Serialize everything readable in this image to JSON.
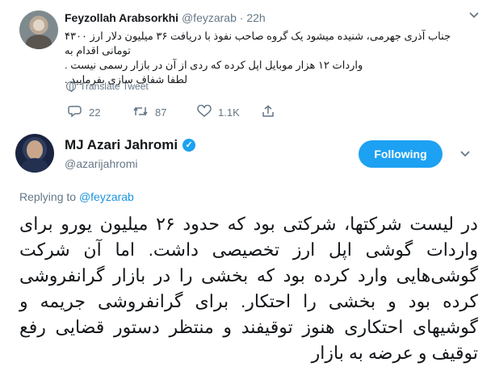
{
  "quoted_tweet": {
    "name": "Feyzollah Arabsorkhi",
    "handle": "@feyzarab",
    "dot": "·",
    "time": "22h",
    "body": [
      "جناب آذری جهرمی، شنیده میشود یک گروه صاحب نفوذ با دریافت ۳۶ میلیون دلار ارز ۴۳۰۰ تومانی اقدام به",
      "واردات ۱۲ هزار موبایل اپل کرده که ردی از آن در بازار رسمی نیست .",
      "لطفا شفاف سازی بفرمایید ."
    ],
    "translate_label": "Translate Tweet",
    "replies": "22",
    "retweets": "87",
    "likes": "1.1K"
  },
  "main_tweet": {
    "name": "MJ Azari Jahromi",
    "handle": "@azarijahromi",
    "follow_label": "Following",
    "replying_prefix": "Replying to",
    "replying_handle": "@feyzarab",
    "body": "در لیست شرکتها، شرکتی بود که حدود ۲۶ میلیون یورو برای واردات گوشی اپل ارز تخصیصی داشت. اما آن شرکت گوشی‌هایی وارد کرده بود که بخشی را در بازار گرانفروشی کرده بود و بخشی را احتکار. برای گرانفروشی جریمه و گوشیهای احتکاری هنوز توقیفند و منتظر دستور قضایی رفع توقیف و عرضه به بازار"
  },
  "colors": {
    "accent": "#1da1f2",
    "link": "#1b95e0",
    "muted": "#657786"
  },
  "icons": [
    "caret-down-icon",
    "globe-icon",
    "reply-icon",
    "retweet-icon",
    "like-icon",
    "share-icon",
    "verified-icon"
  ]
}
